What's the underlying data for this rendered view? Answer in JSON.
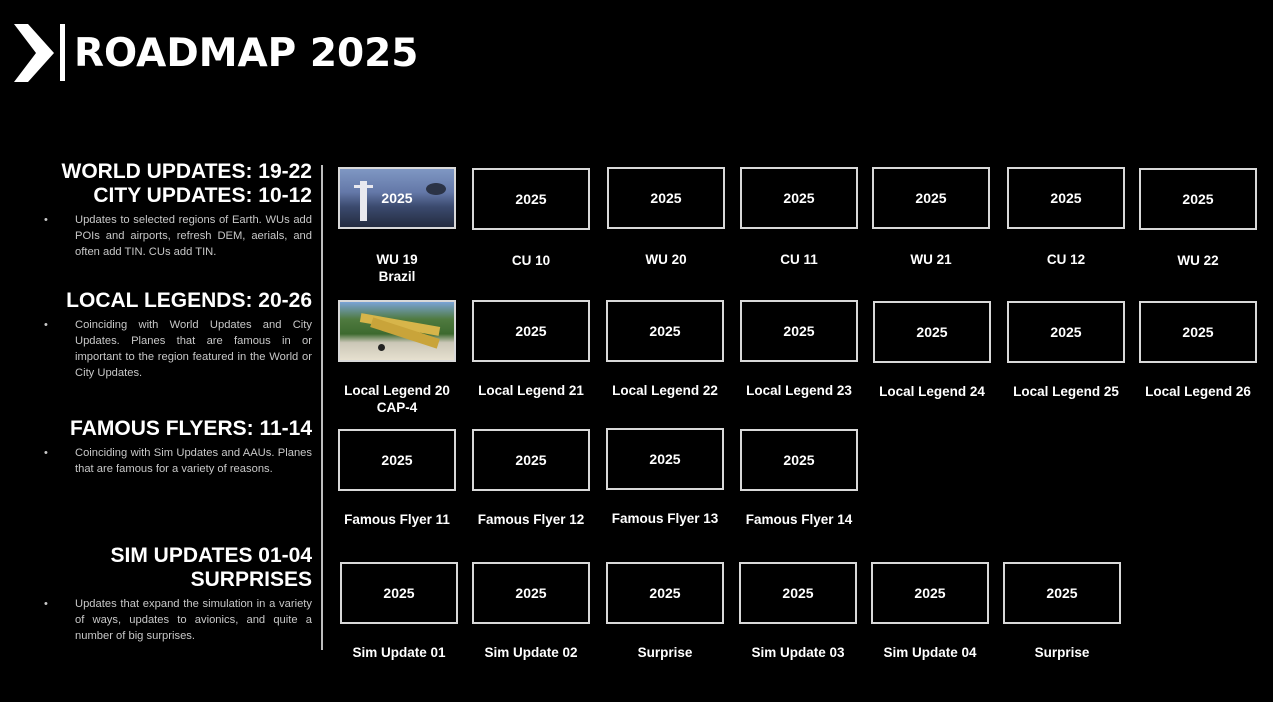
{
  "header": {
    "title": "ROADMAP 2025",
    "logo_icon": "chevron-right-logo-icon"
  },
  "sections": [
    {
      "heading": [
        "WORLD UPDATES: 19-22",
        "CITY UPDATES: 10-12"
      ],
      "bullet": "•",
      "description": "Updates to selected regions of Earth. WUs add POIs and airports, refresh DEM, aerials, and often add TIN. CUs add TIN.",
      "cards": [
        {
          "year": "2025",
          "label": "WU 19",
          "sublabel": "Brazil",
          "image": "rio-christ-redeemer-image"
        },
        {
          "year": "2025",
          "label": "CU 10"
        },
        {
          "year": "2025",
          "label": "WU 20"
        },
        {
          "year": "2025",
          "label": "CU 11"
        },
        {
          "year": "2025",
          "label": "WU 21"
        },
        {
          "year": "2025",
          "label": "CU 12"
        },
        {
          "year": "2025",
          "label": "WU 22"
        }
      ]
    },
    {
      "heading": [
        "LOCAL LEGENDS: 20-26"
      ],
      "bullet": "•",
      "description": "Coinciding with World Updates and City Updates. Planes that are famous in or important to the region featured in the World or City Updates.",
      "cards": [
        {
          "year": "",
          "label": "Local Legend 20",
          "sublabel": "CAP-4",
          "image": "cap4-plane-image"
        },
        {
          "year": "2025",
          "label": "Local Legend 21"
        },
        {
          "year": "2025",
          "label": "Local Legend 22"
        },
        {
          "year": "2025",
          "label": "Local Legend 23"
        },
        {
          "year": "2025",
          "label": "Local Legend 24"
        },
        {
          "year": "2025",
          "label": "Local Legend 25"
        },
        {
          "year": "2025",
          "label": "Local Legend 26"
        }
      ]
    },
    {
      "heading": [
        "FAMOUS FLYERS: 11-14"
      ],
      "bullet": "•",
      "description": "Coinciding with Sim Updates and AAUs. Planes that are famous for a variety of reasons.",
      "cards": [
        {
          "year": "2025",
          "label": "Famous Flyer 11"
        },
        {
          "year": "2025",
          "label": "Famous Flyer 12"
        },
        {
          "year": "2025",
          "label": "Famous Flyer 13"
        },
        {
          "year": "2025",
          "label": "Famous Flyer 14"
        }
      ]
    },
    {
      "heading": [
        "SIM UPDATES 01-04",
        "SURPRISES"
      ],
      "bullet": "•",
      "description": "Updates that expand the simulation in a variety of ways, updates to avionics, and quite a number of big surprises.",
      "cards": [
        {
          "year": "2025",
          "label": "Sim Update 01"
        },
        {
          "year": "2025",
          "label": "Sim Update 02"
        },
        {
          "year": "2025",
          "label": "Surprise"
        },
        {
          "year": "2025",
          "label": "Sim Update 03"
        },
        {
          "year": "2025",
          "label": "Sim Update 04"
        },
        {
          "year": "2025",
          "label": "Surprise"
        }
      ]
    }
  ]
}
